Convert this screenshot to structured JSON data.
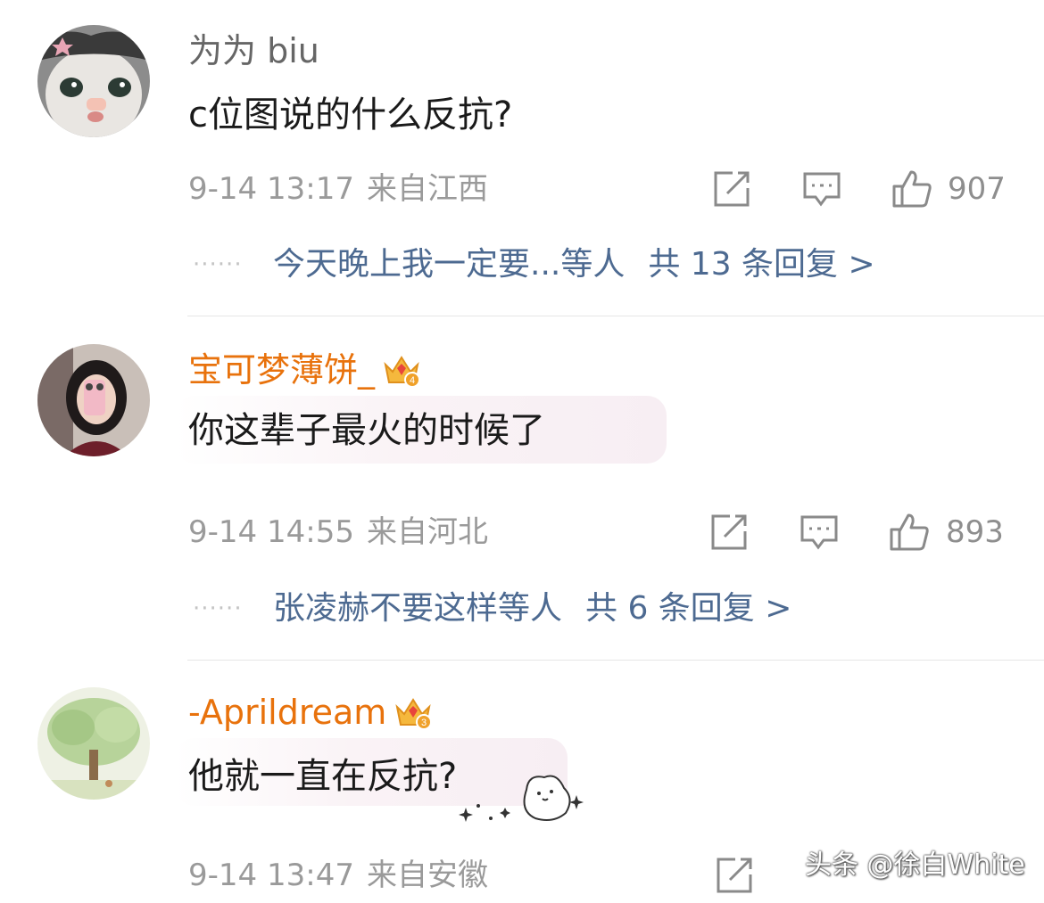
{
  "comments": [
    {
      "username": "为为 biu",
      "text": "c位图说的什么反抗?",
      "date": "9-14 13:17",
      "location": "来自江西",
      "likes": "907",
      "reply_preview": "今天晚上我一定要...等人",
      "reply_total": "共 13 条回复 >",
      "vip": false
    },
    {
      "username": "宝可梦薄饼_",
      "text": "你这辈子最火的时候了",
      "date": "9-14 14:55",
      "location": "来自河北",
      "likes": "893",
      "reply_preview": "张凌赫不要这样等人",
      "reply_total": "共 6 条回复 >",
      "vip": true,
      "vip_level": "4"
    },
    {
      "username": "-Aprildream",
      "text": "他就一直在反抗?",
      "date": "9-14 13:47",
      "location": "来自安徽",
      "vip": true,
      "vip_level": "3"
    }
  ],
  "dots": "······",
  "watermark": "头条 @徐白White",
  "icons": {
    "share": "share-icon",
    "comment": "comment-icon",
    "like": "thumbs-up-icon",
    "crown": "vip-crown-icon"
  },
  "colors": {
    "username_plain": "#666666",
    "username_vip": "#e8720c",
    "reply_link": "#4d6a91",
    "meta": "#9a9a9a"
  }
}
